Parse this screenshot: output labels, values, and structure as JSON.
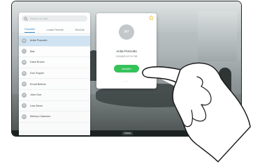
{
  "search": {
    "placeholder": "Search or Dial"
  },
  "tabs": [
    {
      "label": "Favorites",
      "active": true
    },
    {
      "label": "Locate Remote",
      "active": false
    },
    {
      "label": "Recents",
      "active": false
    }
  ],
  "contacts": [
    {
      "initials": "AP",
      "name": "Anita Poscotto",
      "selected": true
    },
    {
      "initials": "B",
      "name": "Bali",
      "selected": false
    },
    {
      "initials": "DB",
      "name": "Dave Brown",
      "selected": false
    },
    {
      "initials": "DS",
      "name": "Don Snyper",
      "selected": false
    },
    {
      "initials": "EB",
      "name": "Emoti Buttner",
      "selected": false
    },
    {
      "initials": "JD",
      "name": "John Doe",
      "selected": false
    },
    {
      "initials": "LS",
      "name": "Lisa Steen",
      "selected": false
    },
    {
      "initials": "MC",
      "name": "Melony Calazons",
      "selected": false
    }
  ],
  "card": {
    "initials": "AP",
    "name": "Anita Poscotto",
    "address": "1234@f2-047-B-768",
    "call_label": "Anrufen",
    "more": "..."
  },
  "bottom_label": "Close",
  "colors": {
    "accent": "#2b85c9",
    "call": "#36c25a",
    "favorite": "#f2c12e"
  }
}
